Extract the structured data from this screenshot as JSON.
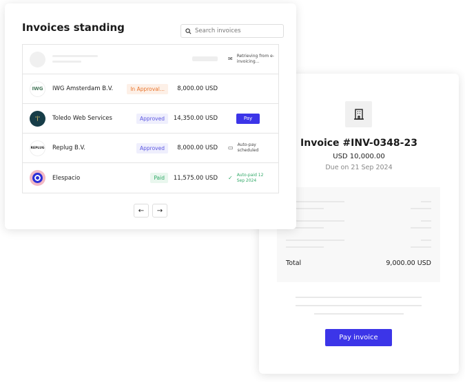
{
  "list": {
    "title": "Invoices standing",
    "search_placeholder": "Search invoices",
    "loading_status": "Retrieving from e-invoicing...",
    "rows": [
      {
        "name": "IWG Amsterdam B.V.",
        "logo": "IWG",
        "badge": "In Approval...",
        "amount": "8,000.00 USD",
        "status": ""
      },
      {
        "name": "Toledo Web Services",
        "logo": "'|'",
        "badge": "Approved",
        "amount": "14,350.00 USD",
        "action": "Pay"
      },
      {
        "name": "Replug B.V.",
        "logo": "REPLUG",
        "badge": "Approved",
        "amount": "8,000.00 USD",
        "status": "Auto-pay scheduled"
      },
      {
        "name": "Elespacio",
        "logo": "",
        "badge": "Paid",
        "amount": "11,575.00 USD",
        "status": "Auto-paid 12 Sep 2024"
      }
    ],
    "prev": "←",
    "next": "→"
  },
  "detail": {
    "icon": "building-icon",
    "title": "Invoice #INV-0348-23",
    "amount": "USD 10,000.00",
    "due": "Due on 21 Sep 2024",
    "total_label": "Total",
    "total_value": "9,000.00 USD",
    "button": "Pay invoice"
  },
  "colors": {
    "accent": "#3c35e8",
    "approval": "#e8742c",
    "approved": "#5a55e0",
    "paid": "#2fa866"
  }
}
